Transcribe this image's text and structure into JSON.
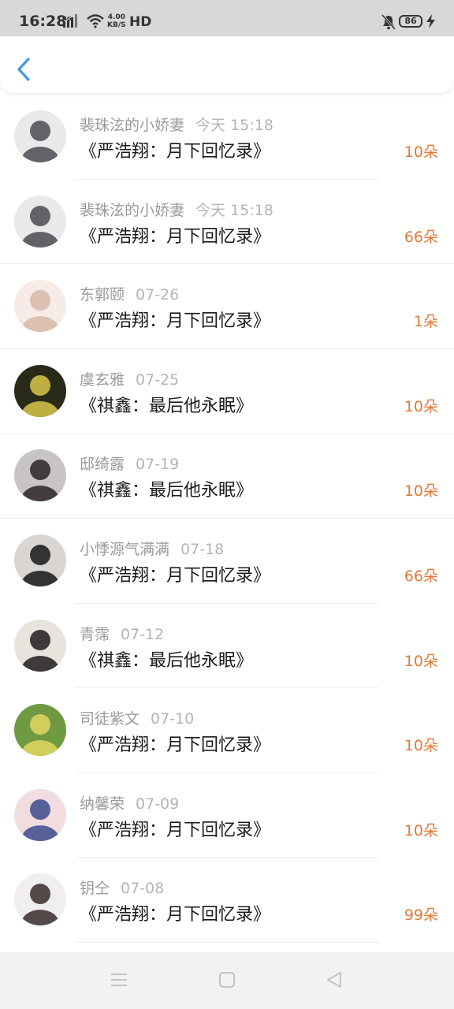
{
  "status_bar": {
    "time": "16:28",
    "network_type": "4G",
    "speed_value": "4.00",
    "speed_unit": "KB/S",
    "hd_label": "HD",
    "battery": "86"
  },
  "header": {
    "back_icon": "chevron-left-icon",
    "accent_color": "#3a9be0"
  },
  "records": [
    {
      "name": "裴珠泫的小娇妻",
      "date": "今天 15:18",
      "gift": "《严浩翔：月下回忆录》",
      "count": "10朵",
      "avatar_colors": [
        "#e9e9ec",
        "#4a4a52"
      ]
    },
    {
      "name": "裴珠泫的小娇妻",
      "date": "今天 15:18",
      "gift": "《严浩翔：月下回忆录》",
      "count": "66朵",
      "avatar_colors": [
        "#e9e9ec",
        "#4a4a52"
      ]
    },
    {
      "name": "东郭颐",
      "date": "07-26",
      "gift": "《严浩翔：月下回忆录》",
      "count": "1朵",
      "avatar_colors": [
        "#f6ebe6",
        "#d7b9a8"
      ]
    },
    {
      "name": "虞玄雅",
      "date": "07-25",
      "gift": "《祺鑫：最后他永眠》",
      "count": "10朵",
      "avatar_colors": [
        "#2a2a1a",
        "#d9c64a"
      ]
    },
    {
      "name": "邸绮露",
      "date": "07-19",
      "gift": "《祺鑫：最后他永眠》",
      "count": "10朵",
      "avatar_colors": [
        "#c8c4c6",
        "#2b2426"
      ]
    },
    {
      "name": "小悸源气满满",
      "date": "07-18",
      "gift": "《严浩翔：月下回忆录》",
      "count": "66朵",
      "avatar_colors": [
        "#d9d5d2",
        "#161616"
      ]
    },
    {
      "name": "青霈",
      "date": "07-12",
      "gift": "《祺鑫：最后他永眠》",
      "count": "10朵",
      "avatar_colors": [
        "#e8e3dc",
        "#1f1c1c"
      ]
    },
    {
      "name": "司徒紫文",
      "date": "07-10",
      "gift": "《严浩翔：月下回忆录》",
      "count": "10朵",
      "avatar_colors": [
        "#6f9a42",
        "#e3d760"
      ]
    },
    {
      "name": "纳馨荣",
      "date": "07-09",
      "gift": "《严浩翔：月下回忆录》",
      "count": "10朵",
      "avatar_colors": [
        "#f1dde0",
        "#3d4a8c"
      ]
    },
    {
      "name": "钥仝",
      "date": "07-08",
      "gift": "《严浩翔：月下回忆录》",
      "count": "99朵",
      "avatar_colors": [
        "#f0eeee",
        "#3a2a2a"
      ]
    }
  ],
  "nav_bar": {
    "menu_icon": "menu-icon",
    "home_icon": "home-icon",
    "back_icon": "back-triangle-icon"
  }
}
